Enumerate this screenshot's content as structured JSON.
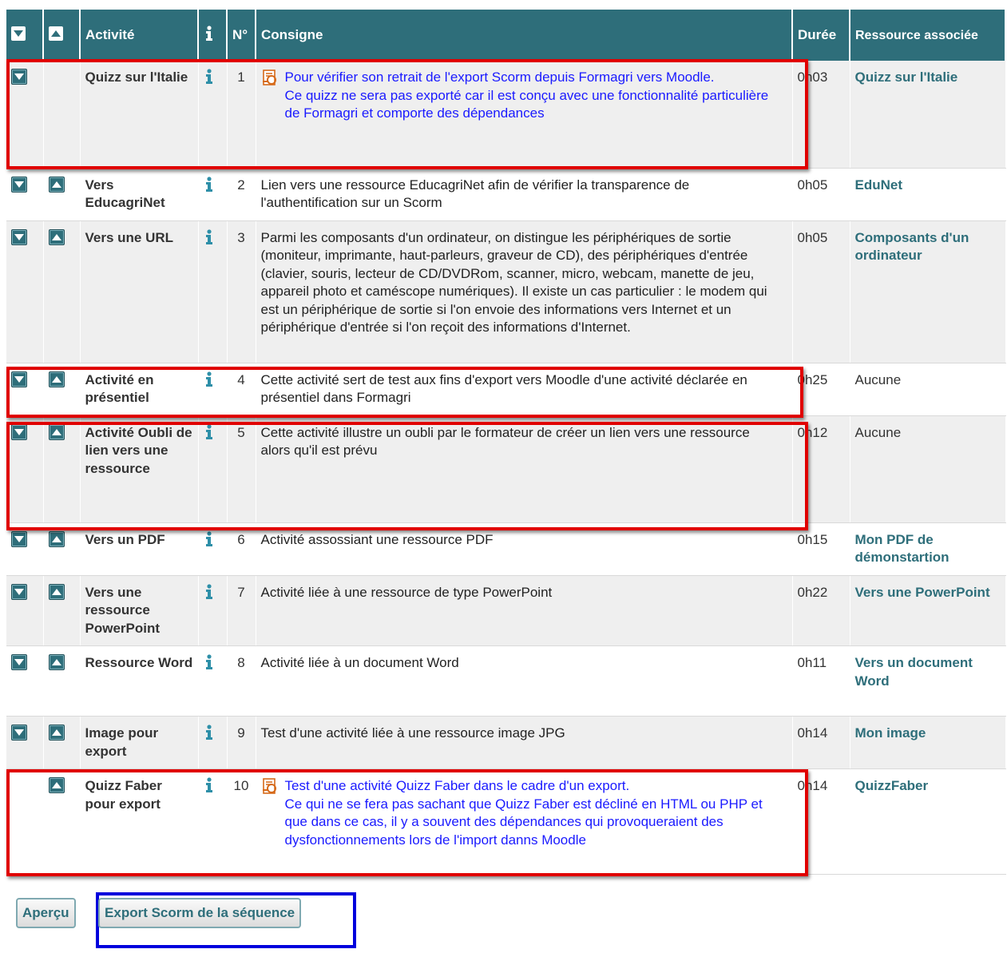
{
  "headers": {
    "activite": "Activité",
    "num": "N°",
    "consigne": "Consigne",
    "duree": "Durée",
    "ressource": "Ressource associée"
  },
  "rows": [
    {
      "activity": "Quizz sur l'Italie",
      "num": "1",
      "consigne": "Pour vérifier son retrait de l'export Scorm depuis Formagri vers Moodle.\nCe quizz ne sera pas exporté car il est conçu avec une fonctionnalité particulière de Formagri et comporte des dépendances",
      "duration": "0h03",
      "resource": "Quizz sur l'Italie"
    },
    {
      "activity": "Vers EducagriNet",
      "num": "2",
      "consigne": "Lien vers une ressource EducagriNet afin de vérifier la transparence de l'authentification sur un Scorm",
      "duration": "0h05",
      "resource": "EduNet"
    },
    {
      "activity": "Vers une URL",
      "num": "3",
      "consigne": "Parmi les composants d'un ordinateur, on distingue les périphériques de sortie (moniteur, imprimante, haut-parleurs, graveur de CD), des périphériques d'entrée (clavier, souris, lecteur de CD/DVDRom, scanner, micro, webcam, manette de jeu, appareil photo et caméscope numériques). Il existe un cas particulier : le modem qui est un périphérique de sortie si l'on envoie des informations vers Internet et un périphérique d'entrée si l'on reçoit des informations d'Internet.",
      "duration": "0h05",
      "resource": "Composants d'un ordinateur"
    },
    {
      "activity": "Activité en présentiel",
      "num": "4",
      "consigne": "Cette activité sert de test aux fins d'export vers Moodle d'une activité déclarée en présentiel dans Formagri",
      "duration": "0h25",
      "resource": "Aucune"
    },
    {
      "activity": "Activité Oubli de lien vers une ressource",
      "num": "5",
      "consigne": "Cette activité illustre un oubli par le formateur de créer un lien vers une ressource alors qu'il est prévu",
      "duration": "0h12",
      "resource": "Aucune"
    },
    {
      "activity": "Vers un PDF",
      "num": "6",
      "consigne": "Activité assossiant une ressource PDF",
      "duration": "0h15",
      "resource": "Mon PDF de démonstartion"
    },
    {
      "activity": "Vers une ressource PowerPoint",
      "num": "7",
      "consigne": "Activité liée à une ressource de type PowerPoint",
      "duration": "0h22",
      "resource": "Vers une PowerPoint"
    },
    {
      "activity": "Ressource Word",
      "num": "8",
      "consigne": "Activité liée à un document Word",
      "duration": "0h11",
      "resource": "Vers un document Word"
    },
    {
      "activity": "Image pour export",
      "num": "9",
      "consigne": "Test d'une activité liée à une ressource image JPG",
      "duration": "0h14",
      "resource": "Mon image"
    },
    {
      "activity": "Quizz Faber pour export",
      "num": "10",
      "consigne": "Test d'une activité Quizz Faber dans le cadre d'un export.\nCe qui ne se fera pas sachant que Quizz Faber est décliné en HTML ou PHP et que dans ce cas, il y a souvent des dépendances qui provoqueraient des dysfonctionnements lors de l'import danns Moodle",
      "duration": "0h14",
      "resource": "QuizzFaber"
    }
  ],
  "buttons": {
    "apercu": "Aperçu",
    "export": "Export Scorm de la séquence"
  },
  "colors": {
    "header_bg": "#2e6e7a",
    "highlight_red": "#e00000",
    "highlight_blue": "#0000dd",
    "consigne_blue": "#1a1aff"
  }
}
